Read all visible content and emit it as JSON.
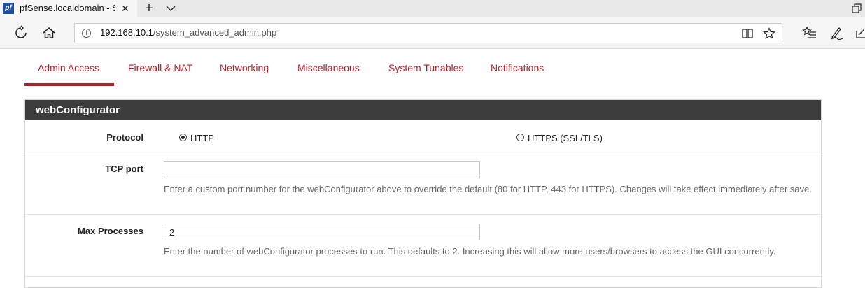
{
  "browser": {
    "tab_title": "pfSense.localdomain - S",
    "favicon_text": "pf",
    "url_host": "192.168.10.1",
    "url_path": "/system_advanced_admin.php"
  },
  "subtabs": [
    {
      "label": "Admin Access",
      "active": true
    },
    {
      "label": "Firewall & NAT",
      "active": false
    },
    {
      "label": "Networking",
      "active": false
    },
    {
      "label": "Miscellaneous",
      "active": false
    },
    {
      "label": "System Tunables",
      "active": false
    },
    {
      "label": "Notifications",
      "active": false
    }
  ],
  "panel": {
    "title": "webConfigurator",
    "protocol": {
      "label": "Protocol",
      "options": [
        {
          "label": "HTTP",
          "checked": true
        },
        {
          "label": "HTTPS (SSL/TLS)",
          "checked": false
        }
      ]
    },
    "tcp_port": {
      "label": "TCP port",
      "value": "",
      "help": "Enter a custom port number for the webConfigurator above to override the default (80 for HTTP, 443 for HTTPS). Changes will take effect immediately after save."
    },
    "max_processes": {
      "label": "Max Processes",
      "value": "2",
      "help": "Enter the number of webConfigurator processes to run. This defaults to 2. Increasing this will allow more users/browsers to access the GUI concurrently."
    }
  },
  "colors": {
    "accent": "#b3232a",
    "panel_header": "#3c3c3c"
  }
}
